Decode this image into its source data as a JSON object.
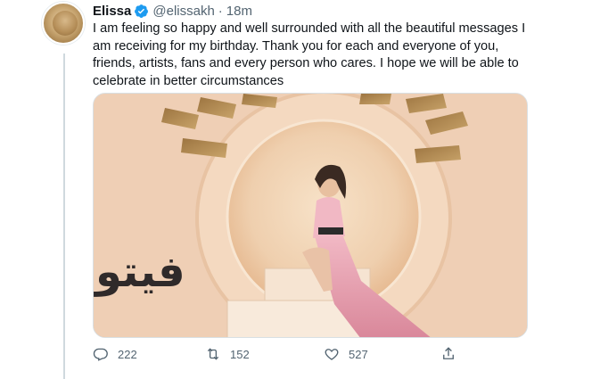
{
  "tweet": {
    "name": "Elissa",
    "handle": "@elissakh",
    "separator": "·",
    "time": "18m",
    "text": "I am feeling so happy and well surrounded with all the beautiful messages I am receiving for my birthday. Thank you for each and everyone of you, friends, artists, fans and every person who cares. I hope we will be able to celebrate in better circumstances",
    "watermark": "فيتو",
    "verified_color": "#1d9bf0"
  },
  "actions": {
    "replies": "222",
    "retweets": "152",
    "likes": "527"
  },
  "icons": [
    "verified-badge-icon",
    "reply-icon",
    "retweet-icon",
    "like-icon",
    "share-icon"
  ]
}
